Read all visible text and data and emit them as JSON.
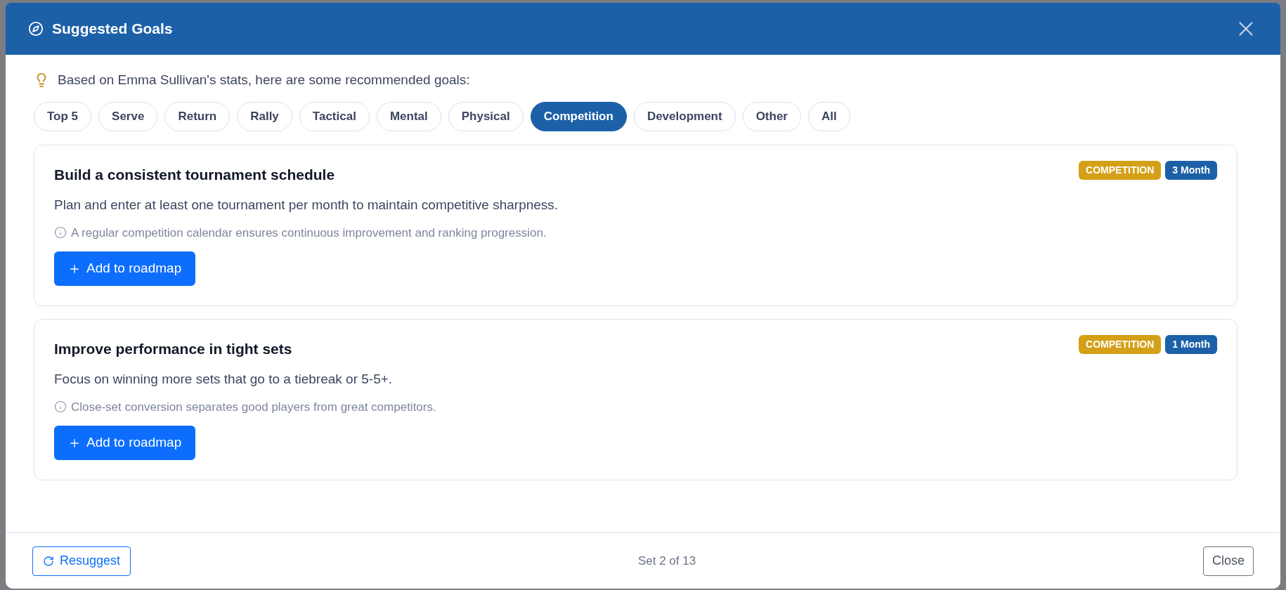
{
  "dialog": {
    "title": "Suggested Goals",
    "intro": "Based on Emma Sullivan's stats, here are some recommended goals:",
    "filters": [
      {
        "label": "Top 5",
        "selected": false
      },
      {
        "label": "Serve",
        "selected": false
      },
      {
        "label": "Return",
        "selected": false
      },
      {
        "label": "Rally",
        "selected": false
      },
      {
        "label": "Tactical",
        "selected": false
      },
      {
        "label": "Mental",
        "selected": false
      },
      {
        "label": "Physical",
        "selected": false
      },
      {
        "label": "Competition",
        "selected": true
      },
      {
        "label": "Development",
        "selected": false
      },
      {
        "label": "Other",
        "selected": false
      },
      {
        "label": "All",
        "selected": false
      }
    ],
    "goals": [
      {
        "title": "Build a consistent tournament schedule",
        "description": "Plan and enter at least one tournament per month to maintain competitive sharpness.",
        "note": "A regular competition calendar ensures continuous improvement and ranking progression.",
        "category": "COMPETITION",
        "duration": "3 Month",
        "action": "Add to roadmap"
      },
      {
        "title": "Improve performance in tight sets",
        "description": "Focus on winning more sets that go to a tiebreak or 5-5+.",
        "note": "Close-set conversion separates good players from great competitors.",
        "category": "COMPETITION",
        "duration": "1 Month",
        "action": "Add to roadmap"
      }
    ],
    "footer": {
      "resuggest": "Resuggest",
      "set_info": "Set 2 of 13",
      "close": "Close"
    }
  }
}
